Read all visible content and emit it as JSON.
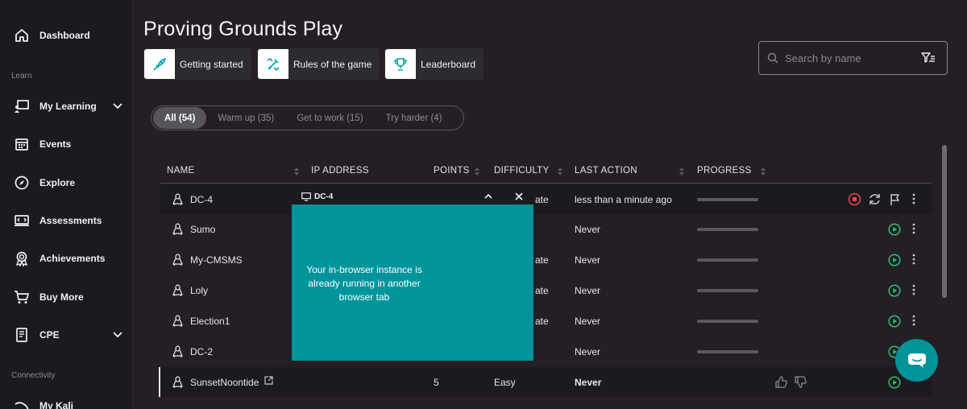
{
  "sidebar": {
    "dashboard": "Dashboard",
    "section_learn": "Learn",
    "my_learning": "My Learning",
    "events": "Events",
    "explore": "Explore",
    "assessments": "Assessments",
    "achievements": "Achievements",
    "buy_more": "Buy More",
    "cpe": "CPE",
    "section_connectivity": "Connectivity",
    "my_kali": "My Kali"
  },
  "header": {
    "title": "Proving Grounds Play",
    "getting_started": "Getting started",
    "rules": "Rules of the game",
    "leaderboard": "Leaderboard",
    "search_placeholder": "Search by name"
  },
  "filters": {
    "all": "All (54)",
    "warm_up": "Warm up (35)",
    "get_to_work": "Get to work (15)",
    "try_harder": "Try harder (4)"
  },
  "table": {
    "headers": {
      "name": "NAME",
      "ip": "IP ADDRESS",
      "points": "POINTS",
      "difficulty": "DIFFICULTY",
      "last_action": "LAST ACTION",
      "progress": "PROGRESS"
    },
    "rows": [
      {
        "name": "DC-4",
        "points": "",
        "difficulty": "ate",
        "last_action": "less than a minute ago"
      },
      {
        "name": "Sumo",
        "points": "",
        "difficulty": "",
        "last_action": "Never"
      },
      {
        "name": "My-CMSMS",
        "points": "",
        "difficulty": "ate",
        "last_action": "Never"
      },
      {
        "name": "Loly",
        "points": "",
        "difficulty": "ate",
        "last_action": "Never"
      },
      {
        "name": "Election1",
        "points": "",
        "difficulty": "ate",
        "last_action": "Never"
      },
      {
        "name": "DC-2",
        "points": "",
        "difficulty": "",
        "last_action": "Never"
      },
      {
        "name": "SunsetNoontide",
        "points": "5",
        "difficulty": "Easy",
        "last_action": "Never"
      }
    ]
  },
  "popup": {
    "title": "DC-4",
    "message": "Your in-browser instance is already running in another browser tab"
  },
  "colors": {
    "accent_teal": "#00959b",
    "play_green": "#2fbf71",
    "stop_red": "#e5484d"
  }
}
